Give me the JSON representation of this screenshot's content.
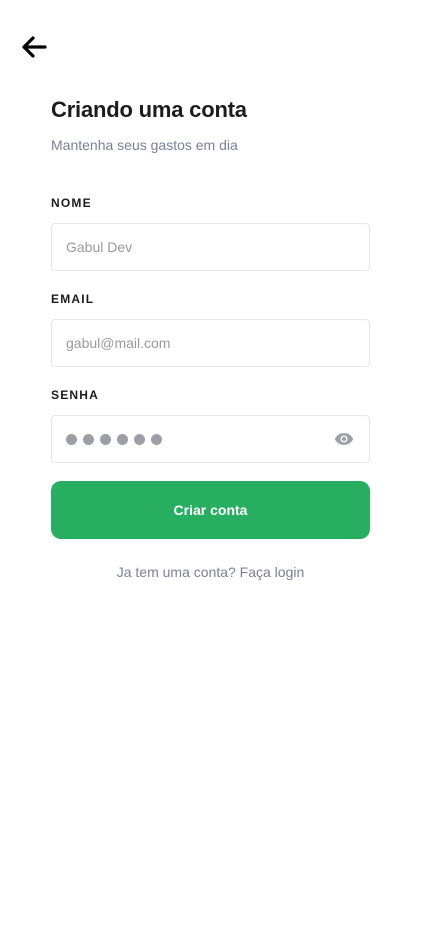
{
  "header": {
    "back_icon": "arrow-left-icon",
    "title": "Criando uma conta",
    "subtitle": "Mantenha seus gastos em dia"
  },
  "form": {
    "name": {
      "label": "NOME",
      "placeholder": "Gabul Dev"
    },
    "email": {
      "label": "EMAIL",
      "placeholder": "gabul@mail.com"
    },
    "password": {
      "label": "SENHA",
      "masked_length": 6,
      "toggle_icon": "eye-icon"
    },
    "submit_label": "Criar conta"
  },
  "footer": {
    "login_link": "Ja tem uma conta? Faça login"
  },
  "colors": {
    "primary": "#27ae60",
    "muted_text": "#7a7f9a",
    "heading_text": "#1c1c1e",
    "input_border": "#e5e5e5"
  }
}
